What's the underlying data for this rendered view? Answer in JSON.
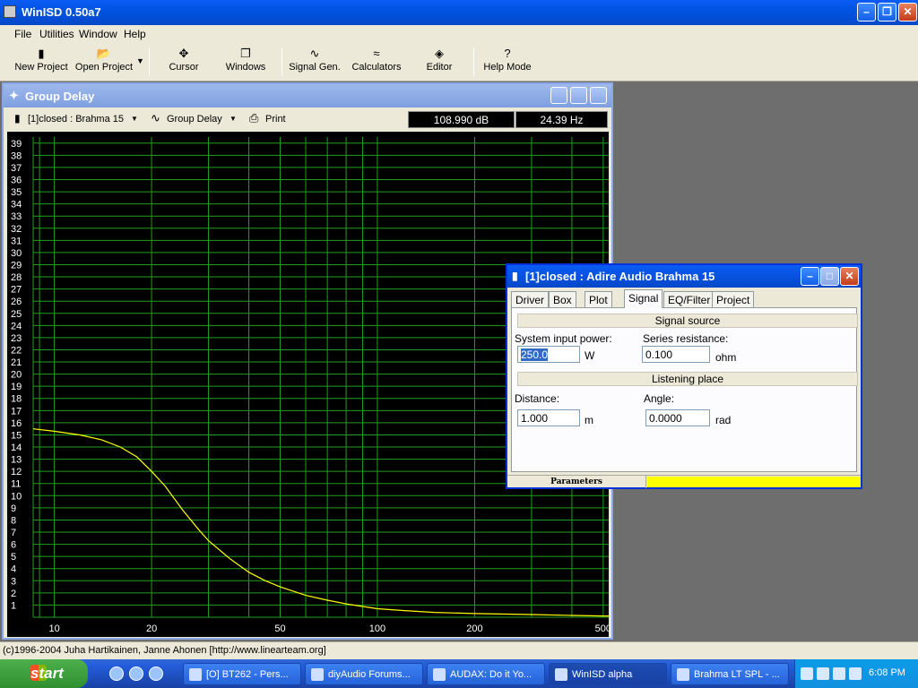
{
  "app": {
    "title": "WinISD 0.50a7"
  },
  "menu": [
    "File",
    "Utilities",
    "Window",
    "Help"
  ],
  "toolbar": {
    "new_project": "New Project",
    "open_project": "Open Project",
    "cursor": "Cursor",
    "windows": "Windows",
    "signal_gen": "Signal Gen.",
    "calculators": "Calculators",
    "editor": "Editor",
    "help_mode": "Help Mode"
  },
  "group_delay_window": {
    "title": "Group Delay",
    "project_selector": "[1]closed : Brahma 15",
    "graph_selector": "Group Delay",
    "print_label": "Print",
    "readout_db": "108.990 dB",
    "readout_hz": "24.39 Hz"
  },
  "chart_data": {
    "type": "line",
    "title": "",
    "xlabel": "",
    "ylabel": "",
    "x_scale": "log",
    "xlim": [
      8.6,
      520
    ],
    "ylim": [
      0,
      39.5
    ],
    "x_ticks": [
      10,
      20,
      50,
      100,
      200,
      500
    ],
    "y_ticks": [
      1,
      2,
      3,
      4,
      5,
      6,
      7,
      8,
      9,
      10,
      11,
      12,
      13,
      14,
      15,
      16,
      17,
      18,
      19,
      20,
      21,
      22,
      23,
      24,
      25,
      26,
      27,
      28,
      29,
      30,
      31,
      32,
      33,
      34,
      35,
      36,
      37,
      38,
      39
    ],
    "grid": true,
    "colors": {
      "background": "#000000",
      "grid": "#1f9f1f",
      "line": "#ffff00"
    },
    "series": [
      {
        "x": [
          8.6,
          10,
          12,
          14,
          16,
          18,
          20,
          22,
          25,
          28,
          30,
          35,
          40,
          45,
          50,
          60,
          70,
          80,
          100,
          120,
          150,
          200,
          300,
          400,
          500,
          520
        ],
        "y": [
          15.5,
          15.3,
          15.0,
          14.6,
          14.0,
          13.2,
          12.0,
          10.8,
          8.8,
          7.2,
          6.3,
          4.8,
          3.7,
          3.0,
          2.5,
          1.8,
          1.4,
          1.1,
          0.7,
          0.55,
          0.4,
          0.3,
          0.22,
          0.15,
          0.1,
          0.1
        ]
      }
    ]
  },
  "signal_window": {
    "title": "[1]closed : Adire Audio Brahma 15",
    "tabs": [
      "Driver",
      "Box",
      "Plot",
      "Signal",
      "EQ/Filter",
      "Project"
    ],
    "selected_tab": "Signal",
    "signal_source_header": "Signal source",
    "system_input_power_label": "System input power:",
    "system_input_power_value": "250.0",
    "system_input_power_unit": "W",
    "series_resistance_label": "Series resistance:",
    "series_resistance_value": "0.100",
    "series_resistance_unit": "ohm",
    "listening_place_header": "Listening place",
    "distance_label": "Distance:",
    "distance_value": "1.000",
    "distance_unit": "m",
    "angle_label": "Angle:",
    "angle_value": "0.0000",
    "angle_unit": "rad",
    "status_label": "Parameters"
  },
  "statusbar": {
    "text": "(c)1996-2004 Juha Hartikainen, Janne Ahonen [http://www.linearteam.org]"
  },
  "taskbar": {
    "start": "start",
    "tasks": [
      "[O] BT262 - Pers...",
      "diyAudio Forums...",
      "AUDAX: Do it Yo...",
      "WinISD alpha",
      "Brahma LT SPL - ..."
    ],
    "active_task": "WinISD alpha",
    "clock": "6:08 PM"
  }
}
